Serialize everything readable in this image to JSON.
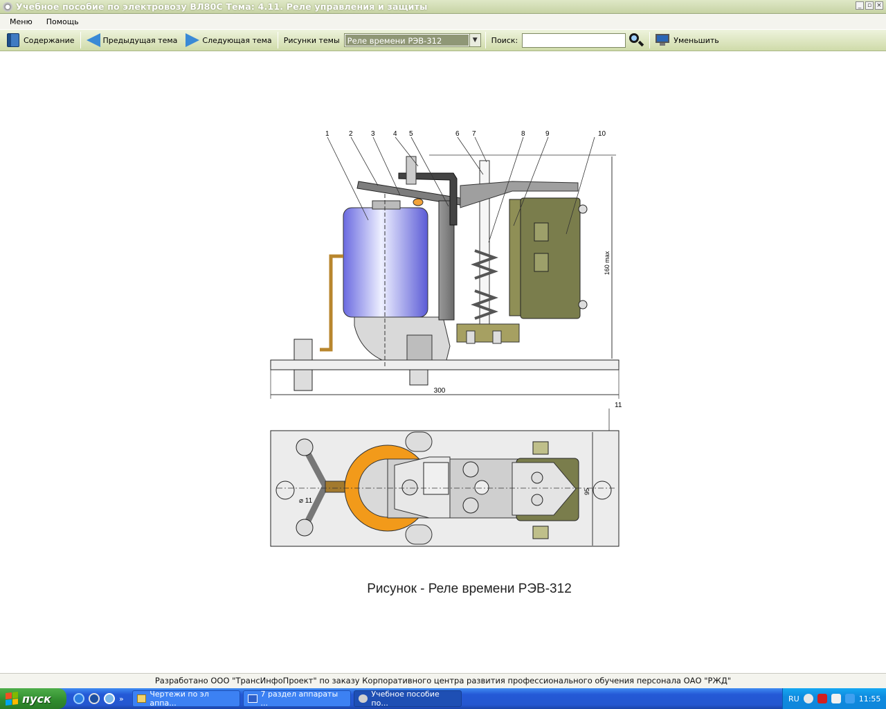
{
  "window": {
    "title": "Учебное пособие по электровозу ВЛ80С Тема: 4.11. Реле управления и защиты",
    "buttons": [
      "_",
      "▫",
      "×"
    ]
  },
  "menu": {
    "items": [
      "Меню",
      "Помощь"
    ]
  },
  "toolbar": {
    "contents_label": "Содержание",
    "prev_label": "Предыдущая тема",
    "next_label": "Следующая тема",
    "figures_label": "Рисунки темы",
    "figure_select_value": "Реле времени РЭВ-312",
    "search_label": "Поиск:",
    "search_value": "",
    "shrink_label": "Уменьшить"
  },
  "figure": {
    "callouts": [
      "1",
      "2",
      "3",
      "4",
      "5",
      "6",
      "7",
      "8",
      "9",
      "10",
      "11"
    ],
    "dim_height": "160 max",
    "dim_width": "300",
    "dim_plan_height": "95",
    "dim_hole": "⌀ 11",
    "caption": "Рисунок - Реле времени РЭВ-312",
    "colors": {
      "coil": "#8a8ae8",
      "armature_plate": "#7f7f7f",
      "contact_block": "#7a7d4c",
      "base": "#e6e6e6",
      "coil_ring_plan": "#f29a1a",
      "lead": "#b8862d"
    }
  },
  "footer": {
    "credits": "Разработано ООО \"ТрансИнфоПроект\" по заказу Корпоративного центра развития профессионального обучения персонала ОАО \"РЖД\""
  },
  "taskbar": {
    "start_label": "пуск",
    "tasks": [
      "Чертежи по эл аппа...",
      "7 раздел аппараты ...",
      "Учебное пособие по..."
    ],
    "tray_lang": "RU",
    "clock": "11:55"
  }
}
